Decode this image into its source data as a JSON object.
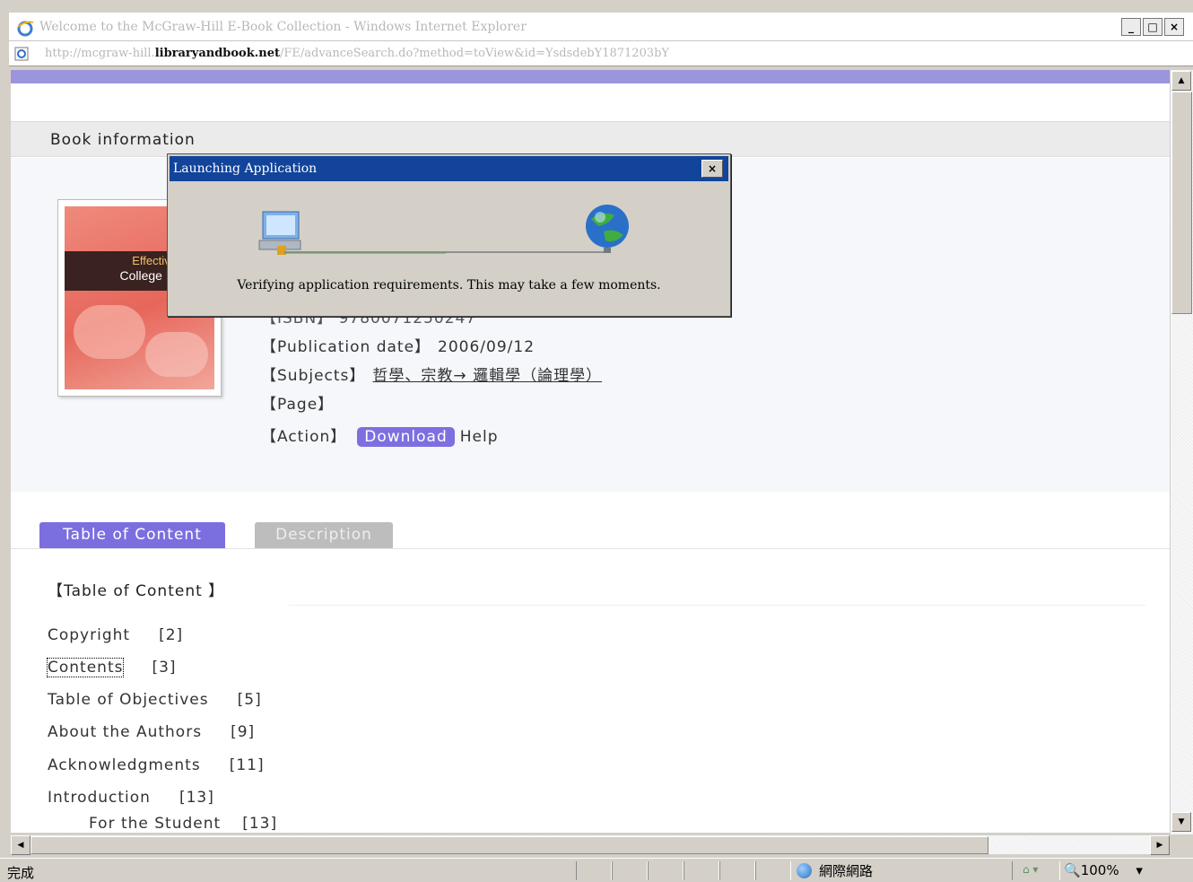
{
  "window": {
    "title": "Welcome to the McGraw-Hill E-Book Collection - Windows Internet Explorer",
    "controls": {
      "minimize": "_",
      "maximize": "□",
      "close": "×"
    }
  },
  "address": {
    "url_prefix": "http://mcgraw-hill.",
    "url_domain": "libraryandbook.net",
    "url_rest": "/FE/advanceSearch.do?method=toView&id=YsdsdebY1871203bY"
  },
  "book": {
    "section_title": "Book information",
    "cover": {
      "line1": "Effective",
      "line2": "College Rea"
    },
    "isbn_partial": "【ISBN】 9780071250247",
    "publication_date_label": "【Publication date】",
    "publication_date": "2006/09/12",
    "subjects_label": "【Subjects】",
    "subjects": "哲學、宗教→ 邏輯學（論理學）",
    "page_label": "【Page】",
    "action_label": "【Action】",
    "download": "Download",
    "help": "Help"
  },
  "tabs": [
    {
      "label": "Table of Content",
      "active": true
    },
    {
      "label": "Description",
      "active": false
    }
  ],
  "toc": {
    "title": "【Table of Content 】",
    "items": [
      {
        "label": "Copyright",
        "page": "[2]"
      },
      {
        "label": "Contents",
        "page": "[3]"
      },
      {
        "label": "Table of Objectives",
        "page": "[5]"
      },
      {
        "label": "About the Authors",
        "page": "[9]"
      },
      {
        "label": "Acknowledgments",
        "page": "[11]"
      },
      {
        "label": "Introduction",
        "page": "[13]"
      },
      {
        "label": "For the Student",
        "page": "[13]"
      }
    ]
  },
  "dialog": {
    "title": "Launching Application",
    "message": "Verifying application requirements. This may take a few moments.",
    "close": "×"
  },
  "statusbar": {
    "status": "完成",
    "zone": "網際網路",
    "zoom": "100%",
    "zoom_arrow": "▾"
  },
  "icons": {
    "app": "ie-icon",
    "dialog_left": "computer-icon",
    "dialog_right": "globe-icon"
  }
}
